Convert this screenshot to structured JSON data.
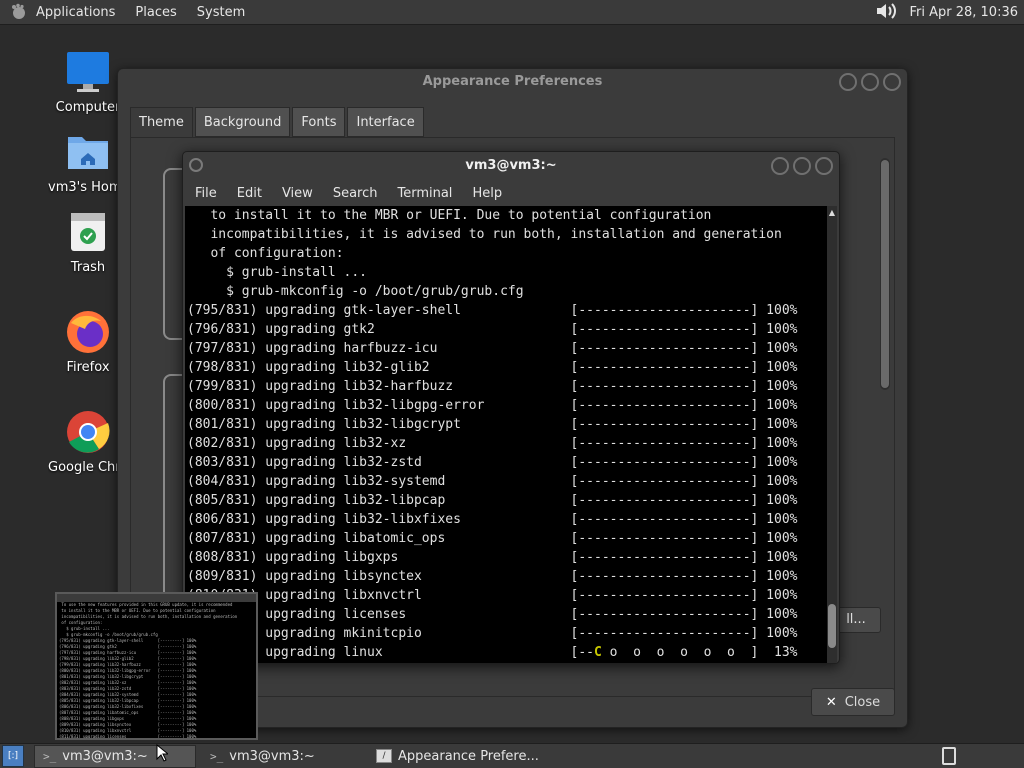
{
  "top_panel": {
    "menus": [
      "Applications",
      "Places",
      "System"
    ],
    "clock": "Fri Apr 28, 10:36"
  },
  "desktop": {
    "icons": [
      {
        "label": "Computer"
      },
      {
        "label": "vm3's Home"
      },
      {
        "label": "Trash"
      },
      {
        "label": "Firefox"
      },
      {
        "label": "Google Chrome"
      }
    ]
  },
  "appearance": {
    "title": "Appearance Preferences",
    "tabs": [
      "Theme",
      "Background",
      "Fonts",
      "Interface"
    ],
    "partial_button": "ll...",
    "close_label": "Close"
  },
  "terminal": {
    "title": "vm3@vm3:~",
    "menus": [
      "File",
      "Edit",
      "View",
      "Search",
      "Terminal",
      "Help"
    ],
    "lines": [
      "   to install it to the MBR or UEFI. Due to potential configuration",
      "   incompatibilities, it is advised to run both, installation and generation",
      "   of configuration:",
      "     $ grub-install ...",
      "     $ grub-mkconfig -o /boot/grub/grub.cfg",
      "(795/831) upgrading gtk-layer-shell              [----------------------] 100%",
      "(796/831) upgrading gtk2                         [----------------------] 100%",
      "(797/831) upgrading harfbuzz-icu                 [----------------------] 100%",
      "(798/831) upgrading lib32-glib2                  [----------------------] 100%",
      "(799/831) upgrading lib32-harfbuzz               [----------------------] 100%",
      "(800/831) upgrading lib32-libgpg-error           [----------------------] 100%",
      "(801/831) upgrading lib32-libgcrypt              [----------------------] 100%",
      "(802/831) upgrading lib32-xz                     [----------------------] 100%",
      "(803/831) upgrading lib32-zstd                   [----------------------] 100%",
      "(804/831) upgrading lib32-systemd                [----------------------] 100%",
      "(805/831) upgrading lib32-libpcap                [----------------------] 100%",
      "(806/831) upgrading lib32-libxfixes              [----------------------] 100%",
      "(807/831) upgrading libatomic_ops                [----------------------] 100%",
      "(808/831) upgrading libgxps                      [----------------------] 100%",
      "(809/831) upgrading libsynctex                   [----------------------] 100%",
      "(810/831) upgrading libxnvctrl                   [----------------------] 100%",
      "(811/831) upgrading licenses                     [----------------------] 100%",
      "(812/831) upgrading mkinitcpio                   [----------------------] 100%",
      "(813/831) upgrading linux                        [--C o  o  o  o  o  o  ]  13%"
    ]
  },
  "thumbnail": {
    "lines": [
      " To use the new features provided in this GRUB update, it is recommended",
      " to install it to the MBR or UEFI. Due to potential configuration",
      " incompatibilities, it is advised to run both, installation and generation",
      " of configuration:",
      "   $ grub-install ...",
      "   $ grub-mkconfig -o /boot/grub/grub.cfg",
      "(795/831) upgrading gtk-layer-shell      [---------] 100%",
      "(796/831) upgrading gtk2                 [---------] 100%",
      "(797/831) upgrading harfbuzz-icu         [---------] 100%",
      "(798/831) upgrading lib32-glib2          [---------] 100%",
      "(799/831) upgrading lib32-harfbuzz       [---------] 100%",
      "(800/831) upgrading lib32-libgpg-error   [---------] 100%",
      "(801/831) upgrading lib32-libgcrypt      [---------] 100%",
      "(802/831) upgrading lib32-xz             [---------] 100%",
      "(803/831) upgrading lib32-zstd           [---------] 100%",
      "(804/831) upgrading lib32-systemd        [---------] 100%",
      "(805/831) upgrading lib32-libpcap        [---------] 100%",
      "(806/831) upgrading lib32-libxfixes      [---------] 100%",
      "(807/831) upgrading libatomic_ops        [---------] 100%",
      "(808/831) upgrading libgxps              [---------] 100%",
      "(809/831) upgrading libsynctex           [---------] 100%",
      "(810/831) upgrading libxnvctrl           [---------] 100%",
      "(811/831) upgrading licenses             [---------] 100%",
      "(812/831) upgrading mkinitcpio           [---------] 100%"
    ]
  },
  "taskbar": {
    "tasks": [
      "vm3@vm3:~",
      "vm3@vm3:~",
      "Appearance Prefere..."
    ]
  },
  "colors": {
    "accent": "#c8c800",
    "terminal_bg": "#000000",
    "firefox": "#ff7139",
    "chrome_red": "#db4437"
  }
}
